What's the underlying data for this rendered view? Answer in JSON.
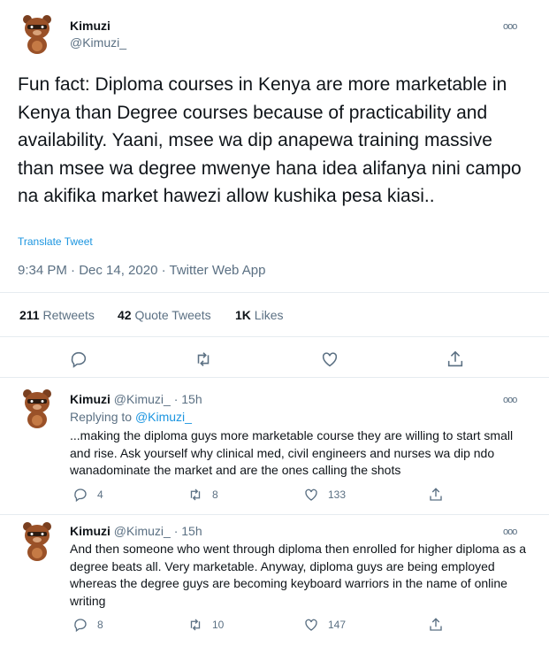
{
  "main_tweet": {
    "author_name": "Kimuzi",
    "author_handle": "@Kimuzi_",
    "text": "Fun fact: Diploma courses in Kenya are more marketable in Kenya than Degree courses because of practicability and availability. Yaani, msee wa dip anapewa training massive than msee wa degree mwenye hana idea alifanya nini campo na akifika market hawezi allow kushika pesa kiasi..",
    "translate_label": "Translate Tweet",
    "timestamp": "9:34 PM · Dec 14, 2020 · Twitter Web App",
    "stats": {
      "retweets_count": "211",
      "retweets_label": "Retweets",
      "quotes_count": "42",
      "quotes_label": "Quote Tweets",
      "likes_count": "1K",
      "likes_label": "Likes"
    }
  },
  "replies": [
    {
      "author_name": "Kimuzi",
      "author_handle": "@Kimuzi_",
      "time": "15h",
      "replying_label": "Replying to",
      "replying_handle": "@Kimuzi_",
      "text": "...making the diploma guys more marketable course they are willing to start small and rise. Ask yourself why clinical med, civil engineers and nurses wa dip ndo wanadominate the market and are the ones calling the shots",
      "reply_count": "4",
      "retweet_count": "8",
      "like_count": "133"
    },
    {
      "author_name": "Kimuzi",
      "author_handle": "@Kimuzi_",
      "time": "15h",
      "text": "And then someone who went through diploma then enrolled for higher diploma as a degree beats all. Very marketable. Anyway, diploma guys are being employed whereas the degree guys are becoming keyboard warriors in the name of online writing",
      "reply_count": "8",
      "retweet_count": "10",
      "like_count": "147"
    }
  ],
  "separator": "·",
  "more_glyph": "ooo",
  "colors": {
    "link": "#1b95e0",
    "muted": "#5b7083",
    "divider": "#e6ecf0",
    "text": "#0f1419"
  },
  "icons": [
    "avatar-bear",
    "more-icon",
    "reply-icon",
    "retweet-icon",
    "like-icon",
    "share-icon"
  ]
}
